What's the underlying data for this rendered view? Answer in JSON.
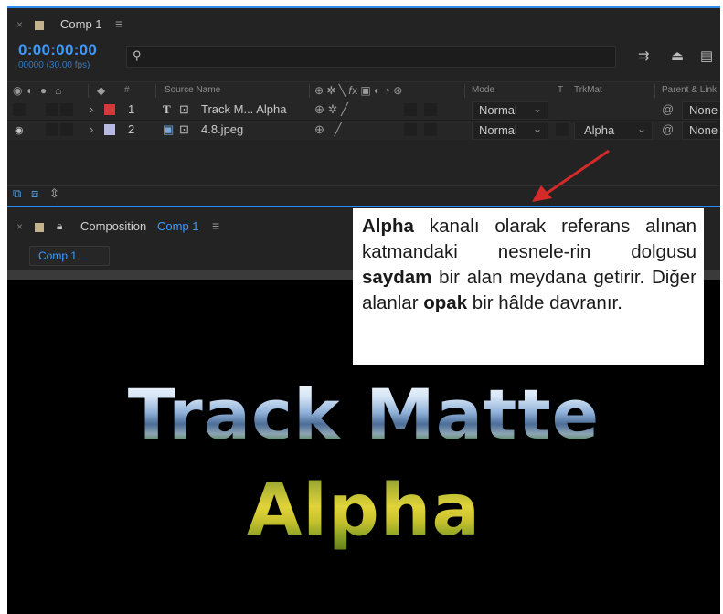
{
  "timeline": {
    "tab_title": "Comp 1",
    "timecode": "0:00:00:00",
    "frames_fps": "00000 (30.00 fps)",
    "search_placeholder": "",
    "columns": {
      "hash": "#",
      "source_name": "Source Name",
      "mode": "Mode",
      "t": "T",
      "trkmat": "TrkMat",
      "parent_link": "Parent & Link"
    },
    "layers": [
      {
        "index": "1",
        "type_glyph": "T",
        "name": "Track M... Alpha",
        "mode": "Normal",
        "trkmat": "",
        "parent": "None",
        "label_color": "#d13b3b",
        "eye_visible": false
      },
      {
        "index": "2",
        "type_glyph": "▣",
        "name": "4.8.jpeg",
        "mode": "Normal",
        "trkmat": "Alpha",
        "parent": "None",
        "label_color": "#b9b9e6",
        "eye_visible": true
      }
    ]
  },
  "composition": {
    "panel_label": "Composition",
    "comp_name": "Comp 1",
    "viewer_button": "Comp 1",
    "preview_line1": "Track Matte",
    "preview_line2": "Alpha"
  },
  "annotation": {
    "segments": [
      {
        "text": "Alpha",
        "bold": true
      },
      {
        "text": " kanalı olarak referans alınan katmandaki nesnele-rin dolgusu ",
        "bold": false
      },
      {
        "text": "saydam",
        "bold": true
      },
      {
        "text": " bir alan meydana getirir. Diğer alanlar ",
        "bold": false
      },
      {
        "text": "opak",
        "bold": true
      },
      {
        "text": " bir hâlde davranır.",
        "bold": false
      }
    ]
  },
  "colors": {
    "accent_blue": "#2d8ceb",
    "timecode_blue": "#3d9bff",
    "panel_bg": "#232323",
    "arrow_red": "#d42a2a"
  }
}
